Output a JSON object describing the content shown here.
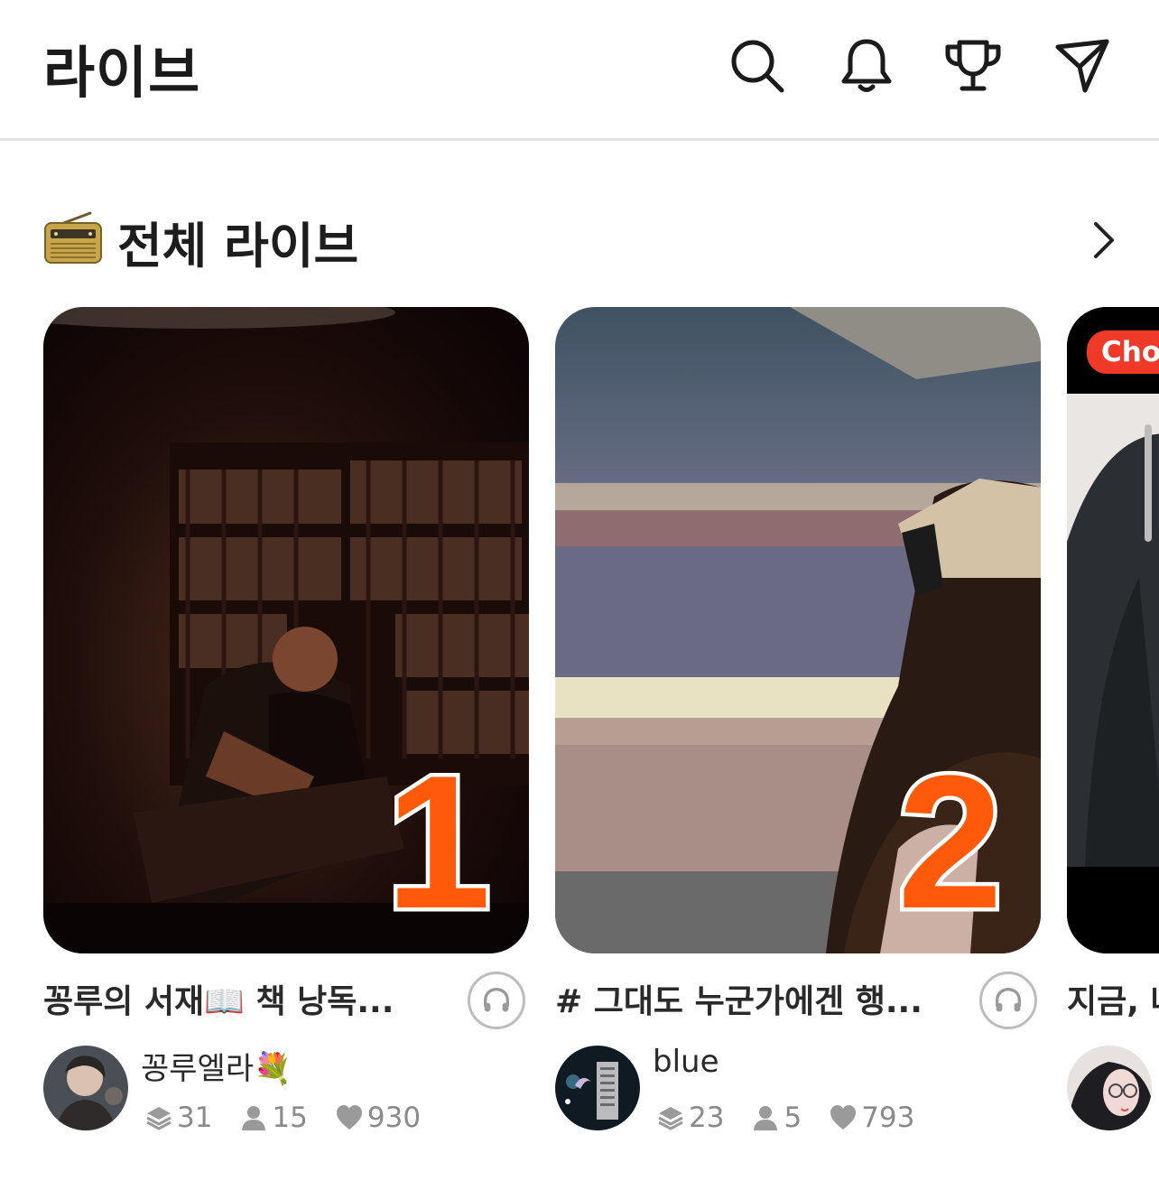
{
  "header": {
    "title": "라이브",
    "icons": [
      "search-icon",
      "bell-icon",
      "trophy-icon",
      "send-icon"
    ]
  },
  "section": {
    "title": "전체 라이브",
    "icon": "radio-icon",
    "more_icon": "chevron-right-icon"
  },
  "cards": [
    {
      "rank": "1",
      "title": "꽁루의 서재📖 책 낭독...",
      "host": "꽁루엘라💐",
      "stats": {
        "episodes": "31",
        "listeners": "15",
        "likes": "930"
      }
    },
    {
      "rank": "2",
      "title": "# 그대도 누군가에겐 행...",
      "host": "blue",
      "stats": {
        "episodes": "23",
        "listeners": "5",
        "likes": "793"
      }
    }
  ],
  "partial_card": {
    "badge": "Choi",
    "title": "지금, 나"
  },
  "colors": {
    "rank_orange": "#ff5a0a",
    "badge_red": "#ef3a2a",
    "stat_gray": "#8a8a8a"
  }
}
